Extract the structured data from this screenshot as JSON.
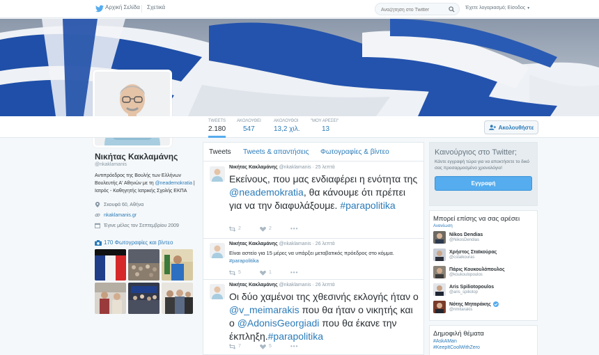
{
  "topnav": {
    "home_label": "Αρχική Σελίδα",
    "about_label": "Σχετικά",
    "search_placeholder": "Αναζήτηση στο Twitter",
    "login_label": "Έχετε λογαριασμό; Είσοδος"
  },
  "stats": [
    {
      "label": "TWEETS",
      "value": "2.180"
    },
    {
      "label": "ΑΚΟΛΟΥΘΕΙ",
      "value": "547"
    },
    {
      "label": "ΑΚΟΛΟΥΘΟΙ",
      "value": "13,2 χιλ."
    },
    {
      "label": "\"ΜΟΥ ΑΡΕΣΕΙ\"",
      "value": "13"
    }
  ],
  "follow_button": "Ακολουθήστε",
  "profile": {
    "name": "Νικήτας Κακλαμάνης",
    "handle": "@nkaklamanis",
    "bio_1": "Αντιπρόεδρος της Βουλής των Ελλήνων Βουλευτής Α' Αθηνών με τη ",
    "bio_link": "@neademokratia",
    "bio_2": " | Ιατρός - Καθηγητής Ιατρικής Σχολής ΕΚΠΑ",
    "location": "Σκουφά 60, Αθήνα",
    "website": "nkaklamanis.gr",
    "joined": "Έγινε μέλος τον Σεπτεμβρίου 2009",
    "photos_link": "170 Φωτογραφίες και βίντεο"
  },
  "tabs": [
    "Tweets",
    "Tweets & απαντήσεις",
    "Φωτογραφίες & βίντεο"
  ],
  "tweets": [
    {
      "name": "Νικήτας Κακλαμάνης",
      "handle": "@nkaklamanis",
      "time": "· 25 λεπτά",
      "text_1": "Εκείνους, που μας ενδιαφέρει η ενότητα της ",
      "link_1": "@neademokratia",
      "text_2": ", θα κάνουμε ότι πρέπει για να την διαφυλάξουμε. ",
      "link_2": "#parapolitika",
      "retweets": "2",
      "likes": "2"
    },
    {
      "name": "Νικήτας Κακλαμάνης",
      "handle": "@nkaklamanis",
      "time": "· 26 λεπτά",
      "text_1": "Είναι αστείο για 15 μέρες να υπάρξει μεταβατικός πρόεδρος στο κόμμα. ",
      "link_1": "#parapolitika",
      "retweets": "5",
      "likes": "1"
    },
    {
      "name": "Νικήτας Κακλαμάνης",
      "handle": "@nkaklamanis",
      "time": "· 26 λεπτά",
      "text_1": "Οι δύο χαμένοι της χθεσινής εκλογής ήταν ο ",
      "link_1": "@v_meimarakis",
      "text_2": " που θα ήταν ο νικητής και ο ",
      "link_2": "@AdonisGeorgiadi",
      "text_3": " που θα έκανε την έκπληξη.",
      "link_3": "#parapolitika",
      "retweets": "7",
      "likes": "5"
    }
  ],
  "signup": {
    "title": "Καινούργιος στο Twitter;",
    "text": "Κάντε εγγραφή τώρα για να αποκτήσετε το δικό σας προσαρμοσμένο χρονολόγιο!",
    "button": "Εγγραφή"
  },
  "who_to_follow": {
    "title": "Μπορεί επίσης να σας αρέσει",
    "refresh": "Ανανέωση",
    "users": [
      {
        "name": "Nikos Dendias",
        "handle": "@NikosDendias"
      },
      {
        "name": "Χρήστος Σταϊκούρας",
        "handle": "@cstaikouras"
      },
      {
        "name": "Πάρις Κουκουλόπουλος",
        "handle": "@koukoulopoulos"
      },
      {
        "name": "Aris Spiliotopoulos",
        "handle": "@aris_spiliotop"
      },
      {
        "name": "Νότης Μηταράκης",
        "handle": "@nmitarakis",
        "verified": true
      }
    ]
  },
  "trends": {
    "title": "Δημοφιλή θέματα",
    "items": [
      "#AskAMan",
      "#KeepItCoolWithZero"
    ]
  },
  "colors": {
    "accent": "#55acee",
    "link": "#2b7bb9",
    "banner_blue": "#1f4fa8"
  }
}
